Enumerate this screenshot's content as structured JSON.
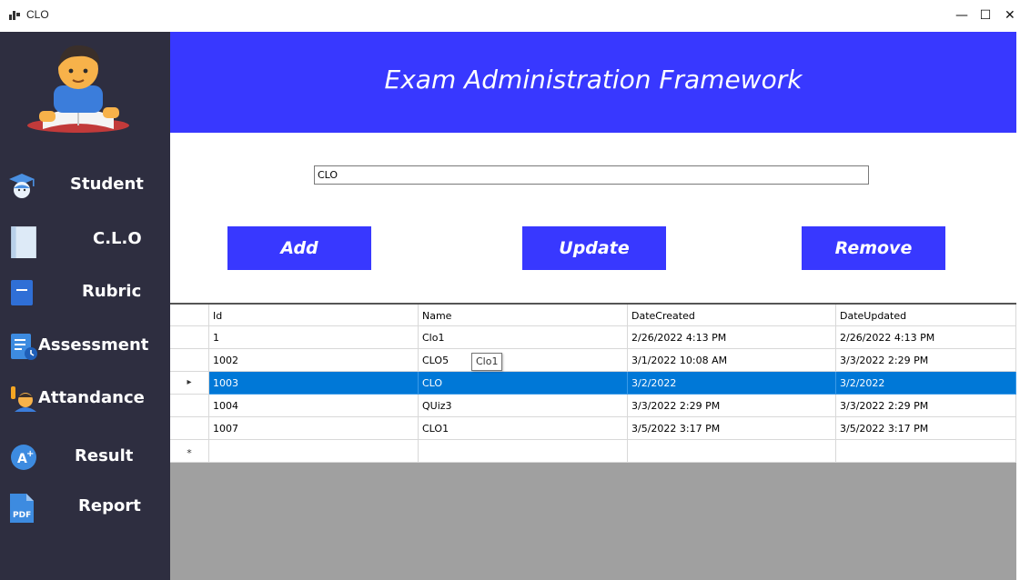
{
  "window": {
    "title": "CLO",
    "minimize": "—",
    "maximize": "☐",
    "close": "✕"
  },
  "header": {
    "title": "Exam Administration Framework"
  },
  "sidebar": {
    "items": [
      {
        "label": "Student",
        "icon": "graduate-icon"
      },
      {
        "label": "C.L.O",
        "icon": "book-icon"
      },
      {
        "label": "Rubric",
        "icon": "notebook-icon"
      },
      {
        "label": "Assessment",
        "icon": "assessment-icon"
      },
      {
        "label": "Attandance",
        "icon": "raised-hand-icon"
      },
      {
        "label": "Result",
        "icon": "grade-icon"
      },
      {
        "label": "Report",
        "icon": "pdf-icon"
      }
    ]
  },
  "form": {
    "name_value": "CLO"
  },
  "actions": {
    "add": "Add",
    "update": "Update",
    "remove": "Remove"
  },
  "table": {
    "columns": [
      "Id",
      "Name",
      "DateCreated",
      "DateUpdated"
    ],
    "rows": [
      {
        "id": "1",
        "name": "Clo1",
        "created": "2/26/2022 4:13 PM",
        "updated": "2/26/2022 4:13 PM"
      },
      {
        "id": "1002",
        "name": "CLO5",
        "created": "3/1/2022 10:08 AM",
        "updated": "3/3/2022 2:29 PM"
      },
      {
        "id": "1003",
        "name": "CLO",
        "created": "3/2/2022",
        "updated": "3/2/2022"
      },
      {
        "id": "1004",
        "name": "QUiz3",
        "created": "3/3/2022 2:29 PM",
        "updated": "3/3/2022 2:29 PM"
      },
      {
        "id": "1007",
        "name": "CLO1",
        "created": "3/5/2022 3:17 PM",
        "updated": "3/5/2022 3:17 PM"
      }
    ],
    "selected_row": 2,
    "new_row_marker": "*",
    "current_row_marker": "▸",
    "tooltip": "Clo1"
  },
  "colors": {
    "sidebar_bg": "#2e2e40",
    "accent": "#3838ff",
    "selection": "#0078d7",
    "grid_bg": "#a0a0a0"
  }
}
